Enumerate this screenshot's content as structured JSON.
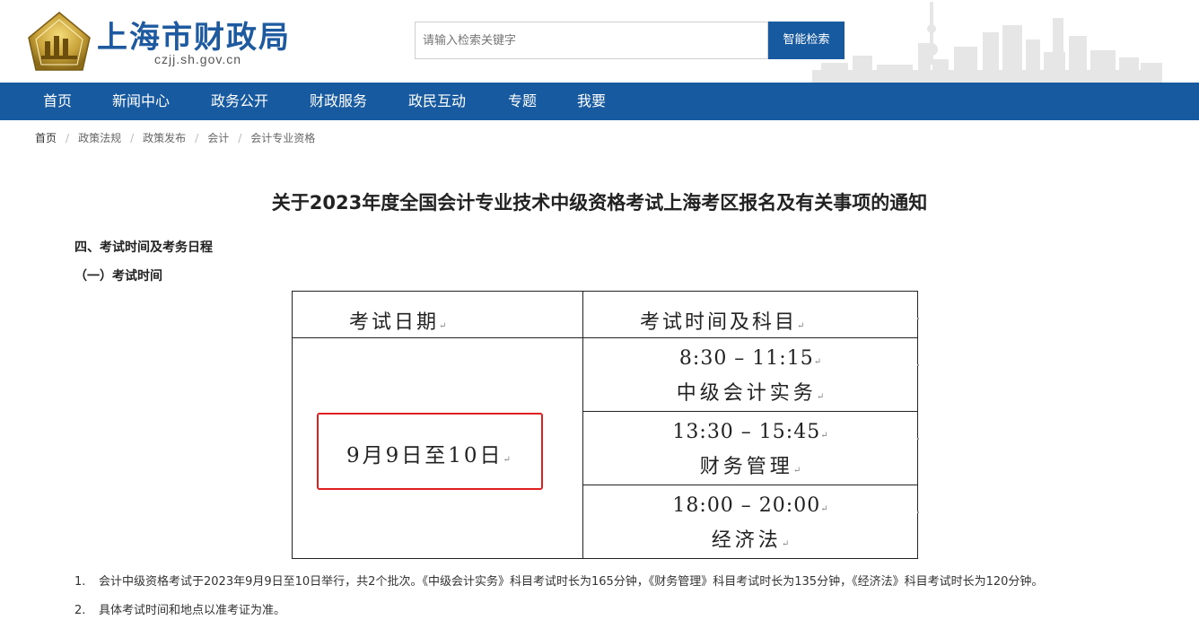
{
  "header": {
    "site_name": "上海市财政局",
    "site_domain": "czjj.sh.gov.cn",
    "logo_icon": "shanghai-finance-emblem",
    "search_placeholder": "请输入检索关键字",
    "search_button": "智能检索"
  },
  "nav": {
    "items": [
      {
        "label": "首页"
      },
      {
        "label": "新闻中心"
      },
      {
        "label": "政务公开"
      },
      {
        "label": "财政服务"
      },
      {
        "label": "政民互动"
      },
      {
        "label": "专题"
      },
      {
        "label": "我要"
      }
    ]
  },
  "breadcrumb": {
    "items": [
      {
        "label": "首页"
      },
      {
        "label": "政策法规"
      },
      {
        "label": "政策发布"
      },
      {
        "label": "会计"
      },
      {
        "label": "会计专业资格"
      }
    ],
    "separator": "/"
  },
  "article": {
    "title": "关于2023年度全国会计专业技术中级资格考试上海考区报名及有关事项的通知",
    "section_heading": "四、考试时间及考务日程",
    "sub_heading": "（一）考试时间",
    "table": {
      "header_date": "考试日期",
      "header_time": "考试时间及科目",
      "date": "9月9日至10日",
      "sessions": [
        {
          "time": "8:30 – 11:15",
          "subject": "中级会计实务"
        },
        {
          "time": "13:30 – 15:45",
          "subject": "财务管理"
        },
        {
          "time": "18:00 – 20:00",
          "subject": "经济法"
        }
      ],
      "paragraph_mark": "↵"
    },
    "notes": [
      {
        "num": "1.",
        "text": "会计中级资格考试于2023年9月9日至10日举行，共2个批次。《中级会计实务》科目考试时长为165分钟，《财务管理》科目考试时长为135分钟，《经济法》科目考试时长为120分钟。"
      },
      {
        "num": "2.",
        "text": "具体考试时间和地点以准考证为准。"
      }
    ]
  },
  "colors": {
    "brand_blue": "#175aa0",
    "logo_gold": "#c9a23a",
    "highlight_red": "#e02020"
  }
}
